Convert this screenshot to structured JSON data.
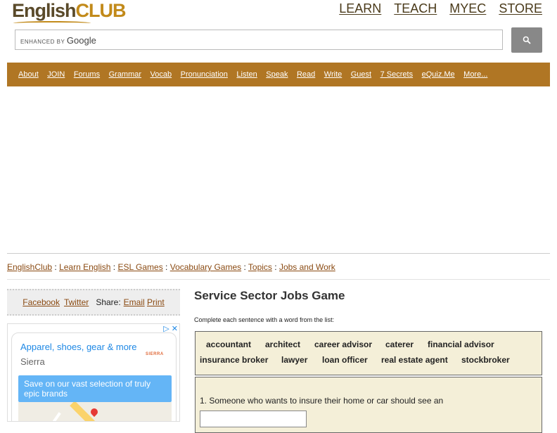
{
  "header": {
    "logo_english": "English",
    "logo_club": "CLUB",
    "topnav": [
      "LEARN",
      "TEACH",
      "MYEC",
      "STORE"
    ],
    "search_placeholder_prefix": "ENHANCED BY",
    "search_placeholder_brand": "Google",
    "search_button_icon": "search-icon"
  },
  "mainnav": [
    "About",
    "JOIN",
    "Forums",
    "Grammar",
    "Vocab",
    "Pronunciation",
    "Listen",
    "Speak",
    "Read",
    "Write",
    "Guest",
    "7 Secrets",
    "eQuiz.Me",
    "More..."
  ],
  "breadcrumb": [
    "EnglishClub",
    "Learn English",
    "ESL Games",
    "Vocabulary Games",
    "Topics",
    "Jobs and Work"
  ],
  "share": {
    "facebook": "Facebook",
    "twitter": "Twitter",
    "label": "Share:",
    "email": "Email",
    "print": "Print"
  },
  "ad": {
    "title": "Apparel, shoes, gear & more",
    "brand": "Sierra",
    "logo": "SIERRA",
    "promo": "Save on our vast selection of truly epic brands"
  },
  "game": {
    "title": "Service Sector Jobs Game",
    "instructions": "Complete each sentence with a word from the list:",
    "words": [
      "accountant",
      "architect",
      "career advisor",
      "caterer",
      "financial advisor",
      "insurance broker",
      "lawyer",
      "loan officer",
      "real estate agent",
      "stockbroker"
    ],
    "question_1": "1. Someone who wants to insure their home or car should see an",
    "answer_1": ""
  },
  "colors": {
    "nav_bg": "#b07624",
    "link": "#8a4a12",
    "wordbank_bg": "#f4efd8",
    "ad_blue": "#1e88e5"
  }
}
